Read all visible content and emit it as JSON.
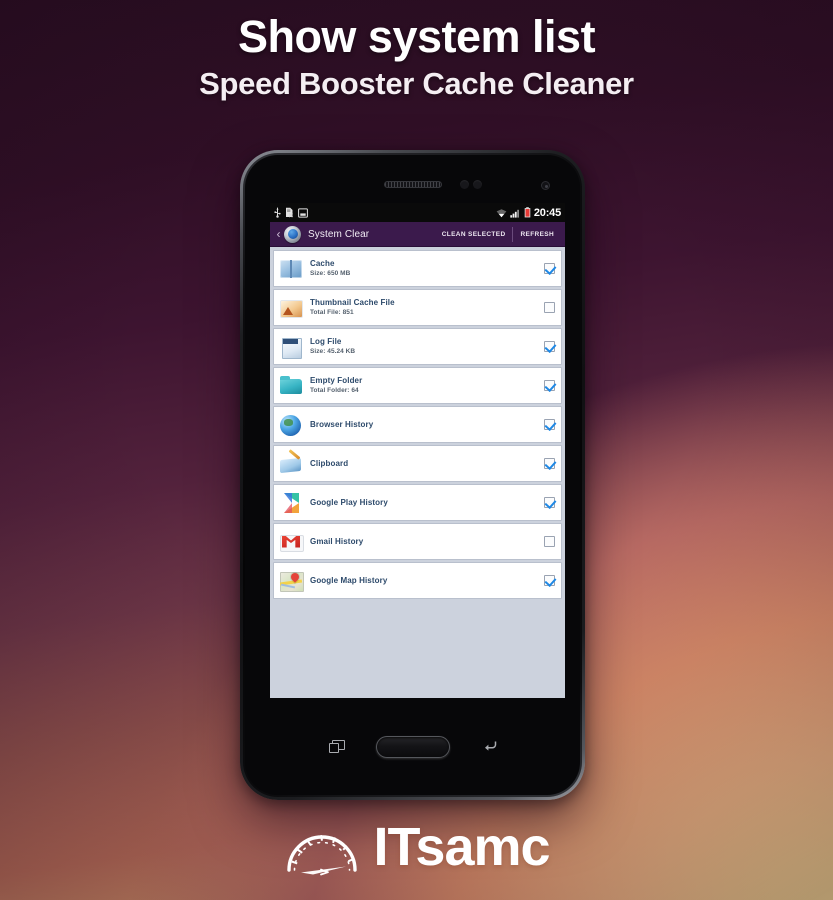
{
  "header": {
    "title": "Show system list",
    "subtitle": "Speed Booster Cache Cleaner"
  },
  "colors": {
    "bg_top": "#2a0e22",
    "bg_bottom_left": "#c9715c",
    "bg_bottom_right": "#f7e49b",
    "actionbar": "#3b1a4c",
    "list_bg": "#ccd2dd",
    "row_bg": "#ffffff",
    "row_title": "#2d4a6b",
    "row_sub": "#55616e",
    "checkbox_accent": "#1e88e5"
  },
  "phone": {
    "statusbar": {
      "time": "20:45",
      "left_icons": [
        "usb-icon",
        "sd-card-icon",
        "screenshot-icon"
      ],
      "right_icons": [
        "wifi-icon",
        "signal-icon",
        "battery-icon"
      ]
    },
    "actionbar": {
      "back_glyph": "‹",
      "app_icon": "system-clear-app-icon",
      "title": "System Clear",
      "actions": [
        {
          "label": "CLEAN SELECTED",
          "name": "clean-selected"
        },
        {
          "label": "REFRESH",
          "name": "refresh"
        }
      ]
    },
    "nav": {
      "recents": "recent-apps-button",
      "home": "home-button",
      "back": "back-button"
    }
  },
  "list": {
    "items": [
      {
        "title": "Cache",
        "sub": "Size: 650 MB",
        "checked": true,
        "icon": "cache-icon"
      },
      {
        "title": "Thumbnail Cache File",
        "sub": "Total File: 851",
        "checked": false,
        "icon": "thumbnail-icon"
      },
      {
        "title": "Log File",
        "sub": "Size: 45.24 KB",
        "checked": true,
        "icon": "log-file-icon"
      },
      {
        "title": "Empty Folder",
        "sub": "Total Folder: 64",
        "checked": true,
        "icon": "folder-icon"
      },
      {
        "title": "Browser History",
        "sub": "",
        "checked": true,
        "icon": "globe-icon"
      },
      {
        "title": "Clipboard",
        "sub": "",
        "checked": true,
        "icon": "clipboard-icon"
      },
      {
        "title": "Google Play History",
        "sub": "",
        "checked": true,
        "icon": "google-play-icon"
      },
      {
        "title": "Gmail History",
        "sub": "",
        "checked": false,
        "icon": "gmail-icon"
      },
      {
        "title": "Google Map History",
        "sub": "",
        "checked": true,
        "icon": "google-maps-icon"
      }
    ]
  },
  "logo": {
    "text": "ITsamc",
    "mark": "speedometer-gauge-icon"
  }
}
